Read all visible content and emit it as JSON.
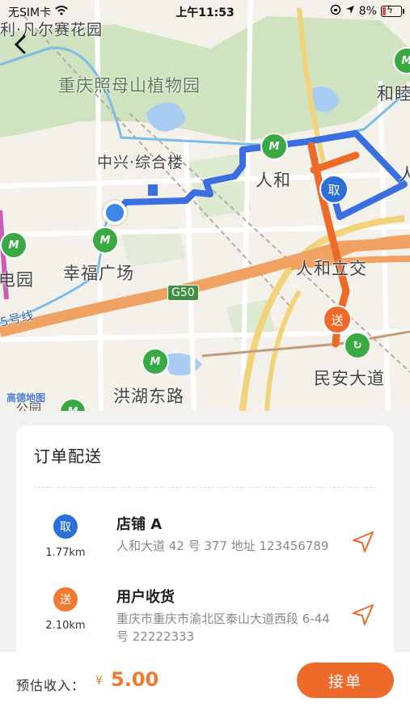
{
  "status_bar": {
    "carrier": "无SIM卡",
    "time": "上午11:53",
    "battery": "8%"
  },
  "map": {
    "labels": {
      "top_left": "利·凡尔赛花园",
      "park": "重庆照母山植物园",
      "zhongxing": "中兴·综合楼",
      "renhe": "人和",
      "he_right": "和睦",
      "ren_right": "人",
      "xingfu": "幸福广场",
      "yuan": "电园",
      "renhe_interchange": "人和立交",
      "minan": "民安大道",
      "honghu": "洪湖东路",
      "line5": "5号线",
      "highway": "G50",
      "logo": "高德地图",
      "bottom_left": "公园"
    },
    "pickup_marker": "取",
    "dropoff_marker": "送",
    "route_colors": {
      "pickup_leg": "#3b6fe0",
      "delivery_leg": "#ec6a2a"
    }
  },
  "order": {
    "title": "订单配送",
    "stops": [
      {
        "badge": "取",
        "distance": "1.77km",
        "name": "店铺 A",
        "address": "人和大道 42 号 377 地址 123456789"
      },
      {
        "badge": "送",
        "distance": "2.10km",
        "name": "用户收货",
        "address": "重庆市重庆市渝北区泰山大道西段 6-44 号 22222333"
      }
    ]
  },
  "footer": {
    "income_label": "预估收入：",
    "currency": "¥",
    "amount": "5.00",
    "accept_label": "接单"
  },
  "colors": {
    "accent": "#ee6a2b",
    "pickup": "#2c6fd6"
  }
}
